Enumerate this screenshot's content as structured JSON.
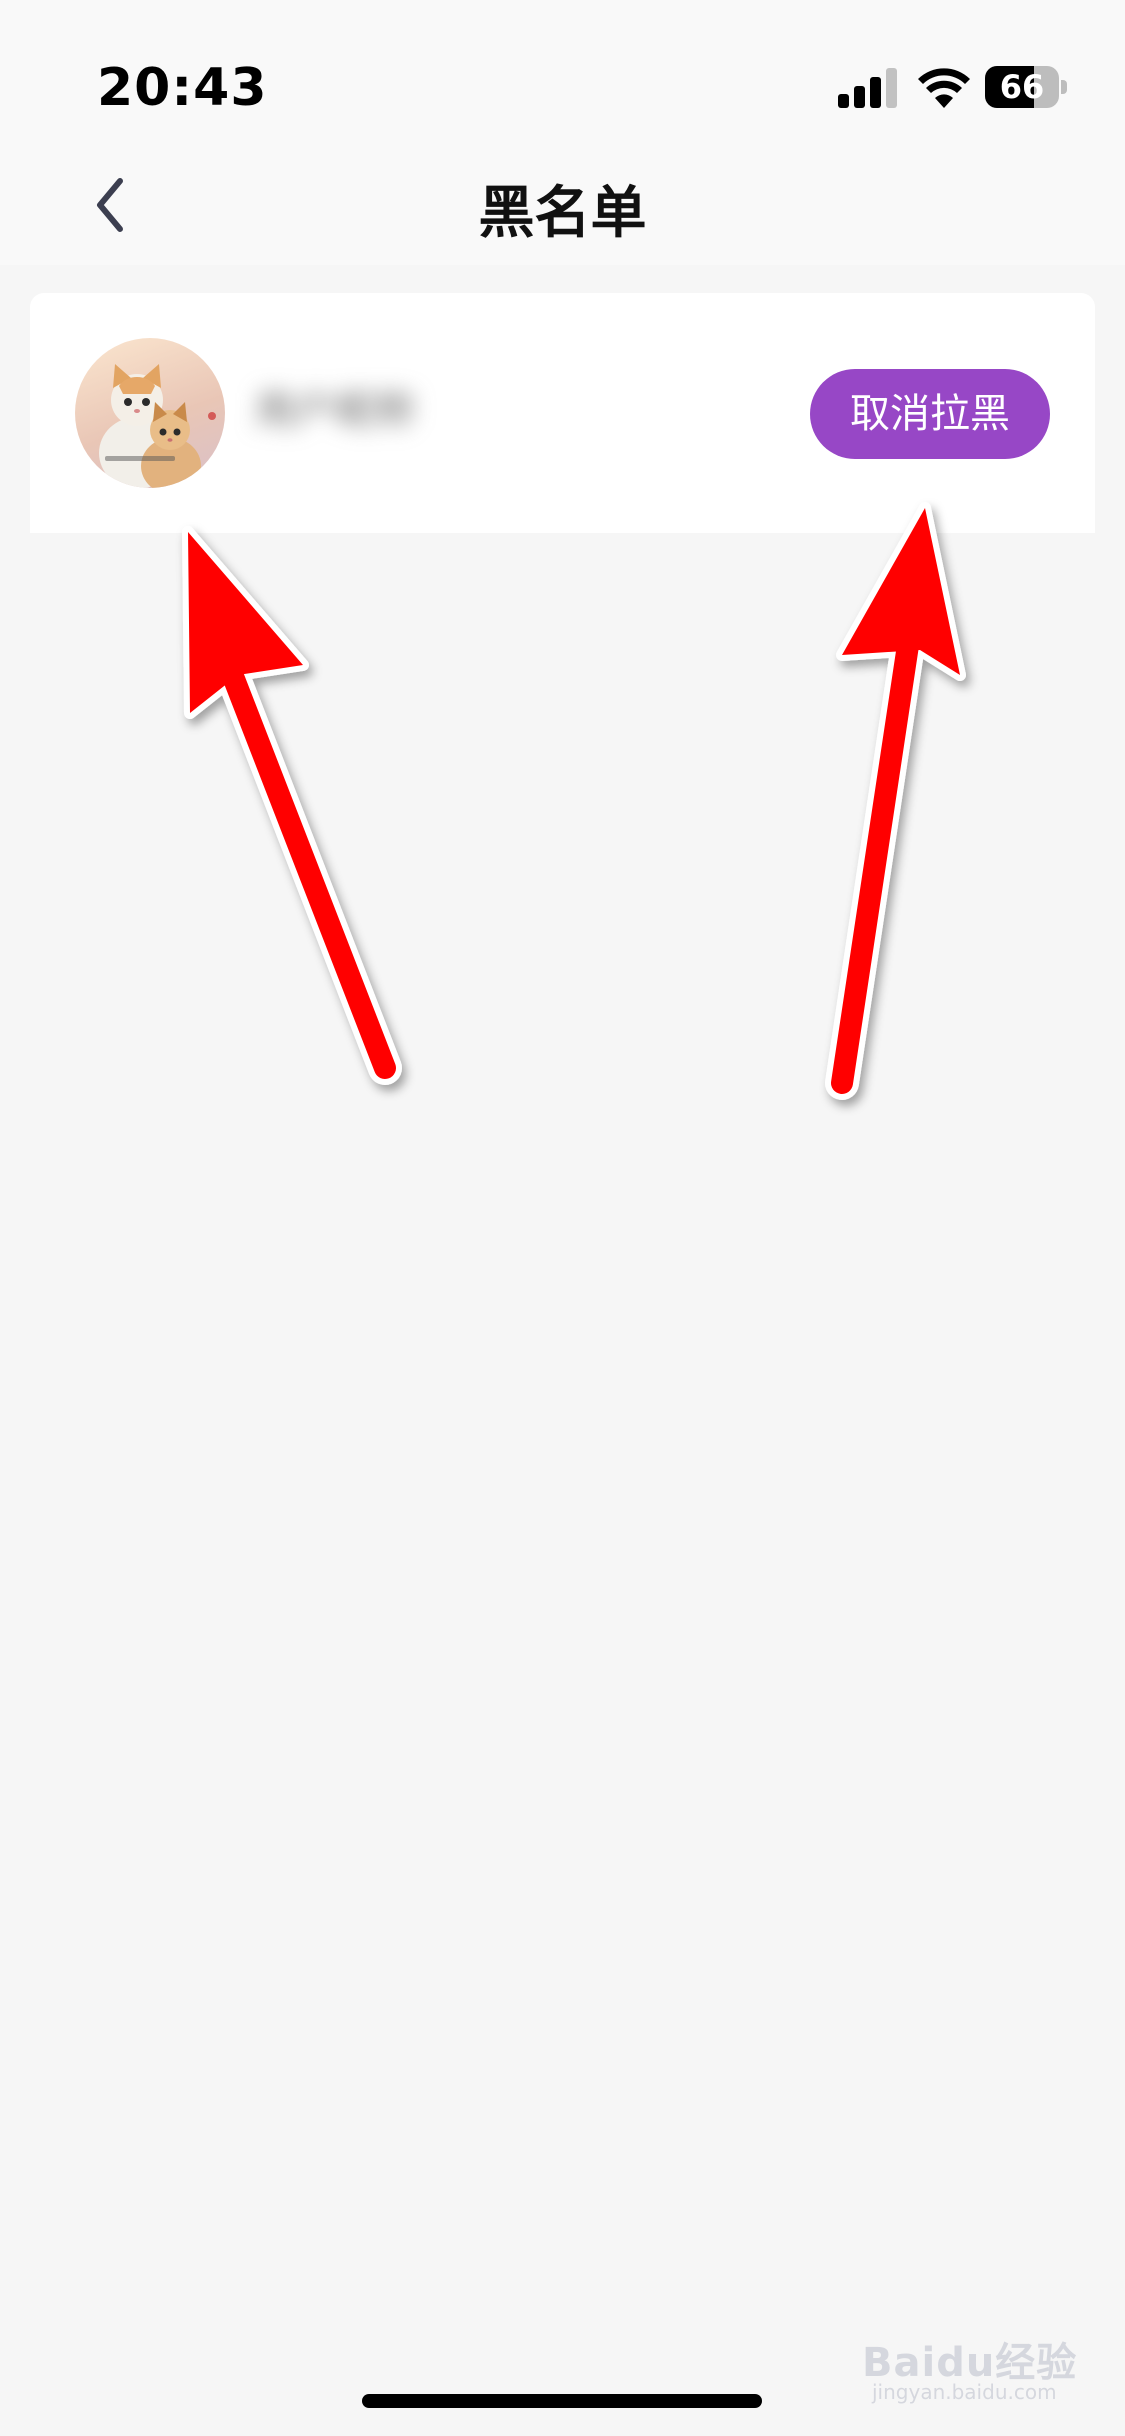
{
  "status_bar": {
    "time": "20:43",
    "battery_level": "66",
    "icons": [
      "signal-icon",
      "wifi-icon",
      "battery-icon"
    ]
  },
  "nav": {
    "back_icon": "chevron-left-icon",
    "title": "黑名单"
  },
  "blocked_list": [
    {
      "avatar_icon": "cat-avatar",
      "name": "用户昵称",
      "unblock_label": "取消拉黑"
    }
  ],
  "colors": {
    "accent": "#9747c6",
    "annotation_arrow": "#ff0000",
    "background": "#f6f6f6"
  },
  "watermark": {
    "logo": "Baidu经验",
    "url": "jingyan.baidu.com"
  }
}
